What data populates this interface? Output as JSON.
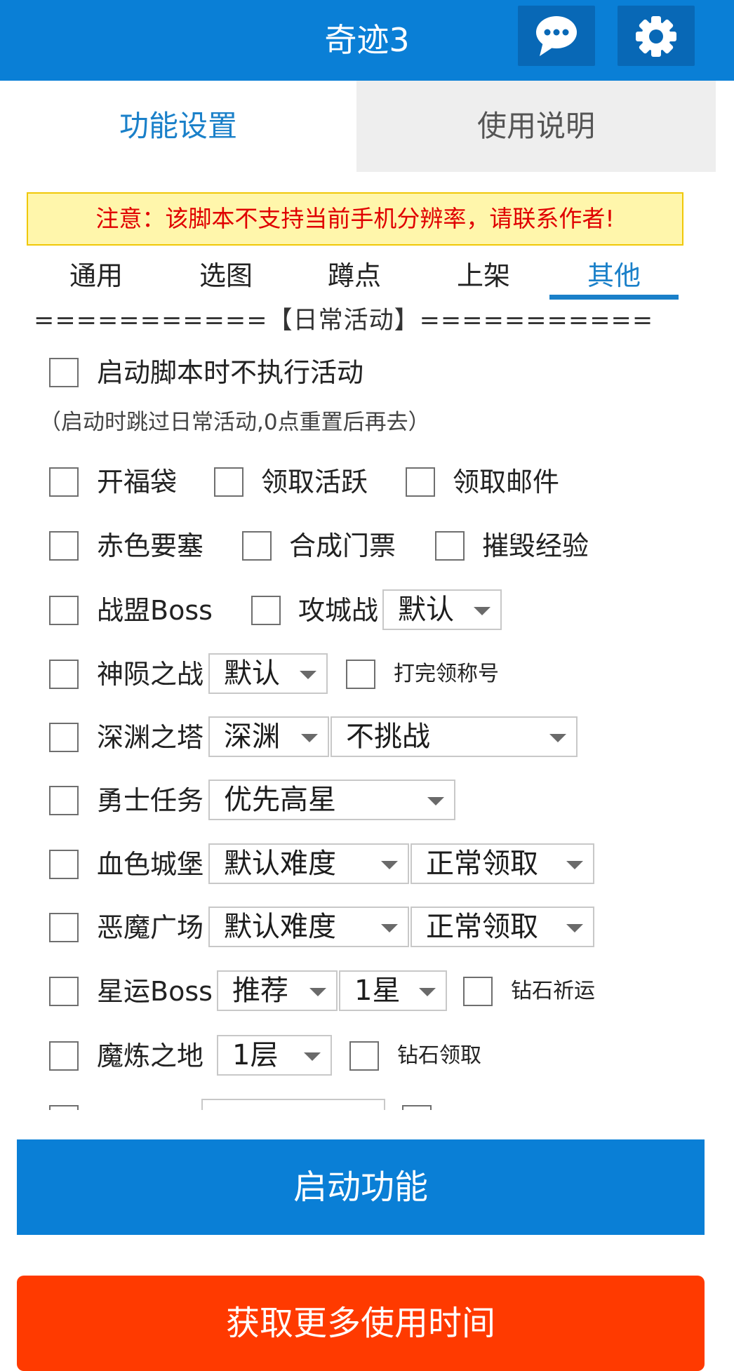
{
  "header": {
    "title": "奇迹3",
    "chat_icon": "chat-bubble-icon",
    "settings_icon": "gear-icon",
    "color": "#0a7fd6"
  },
  "tabs": [
    {
      "label": "功能设置",
      "active": true
    },
    {
      "label": "使用说明",
      "active": false
    }
  ],
  "notice": "注意：该脚本不支持当前手机分辨率，请联系作者!",
  "subtabs": [
    {
      "label": "通用"
    },
    {
      "label": "选图"
    },
    {
      "label": "蹲点"
    },
    {
      "label": "上架"
    },
    {
      "label": "其他",
      "active": true
    }
  ],
  "section": {
    "header": "===========【日常活动】===========",
    "skip_label": "启动脚本时不执行活动",
    "skip_note": "（启动时跳过日常活动,0点重置后再去）"
  },
  "rows": {
    "r1": {
      "a": "开福袋",
      "b": "领取活跃",
      "c": "领取邮件"
    },
    "r2": {
      "a": "赤色要塞",
      "b": "合成门票",
      "c": "摧毁经验"
    },
    "r3": {
      "a": "战盟Boss",
      "b": "攻城战",
      "sel": "默认"
    },
    "r4": {
      "a": "神陨之战",
      "sel": "默认",
      "b": "打完领称号"
    },
    "r5": {
      "a": "深渊之塔",
      "sel1": "深渊",
      "sel2": "不挑战"
    },
    "r6": {
      "a": "勇士任务",
      "sel": "优先高星"
    },
    "r7": {
      "a": "血色城堡",
      "sel1": "默认难度",
      "sel2": "正常领取"
    },
    "r8": {
      "a": "恶魔广场",
      "sel1": "默认难度",
      "sel2": "正常领取"
    },
    "r9": {
      "a": "星运Boss",
      "sel1": "推荐",
      "sel2": "1星",
      "b": "钻石祈运"
    },
    "r10": {
      "a": "魔炼之地",
      "sel": "1层",
      "b": "钻石领取"
    }
  },
  "buttons": {
    "start": "启动功能",
    "more_time": "获取更多使用时间"
  },
  "colors": {
    "accent": "#1a80c9",
    "warning": "#e00000",
    "cta": "#ff3a00"
  }
}
